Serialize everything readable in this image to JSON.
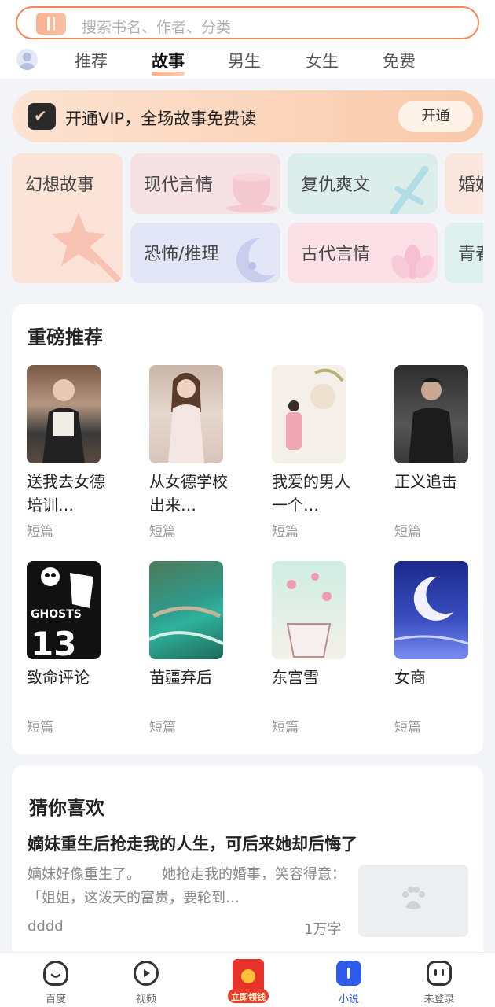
{
  "search": {
    "placeholder": "搜索书名、作者、分类"
  },
  "tabs": [
    "推荐",
    "故事",
    "男生",
    "女生",
    "免费"
  ],
  "active_tab": "故事",
  "vip": {
    "text": "开通VIP，全场故事免费读",
    "button": "开通"
  },
  "categories": [
    "幻想故事",
    "现代言情",
    "复仇爽文",
    "婚姻",
    "恐怖/推理",
    "古代言情",
    "青春"
  ],
  "featured": {
    "title": "重磅推荐",
    "books": [
      {
        "title": "送我去女德培训…",
        "tag": "短篇"
      },
      {
        "title": "从女德学校出来…",
        "tag": "短篇"
      },
      {
        "title": "我爱的男人一个…",
        "tag": "短篇"
      },
      {
        "title": "正义追击",
        "tag": "短篇"
      },
      {
        "title": "致命评论",
        "tag": "短篇"
      },
      {
        "title": "苗疆弃后",
        "tag": "短篇"
      },
      {
        "title": "东宫雪",
        "tag": "短篇"
      },
      {
        "title": "女商",
        "tag": "短篇"
      }
    ]
  },
  "guess": {
    "title": "猜你喜欢",
    "item_title": "嫡妹重生后抢走我的人生，可后来她却后悔了",
    "desc": "嫡妹好像重生了。　　她抢走我的婚事，笑容得意：　　「姐姐，这泼天的富贵，要轮到…",
    "author": "dddd",
    "word_count": "1万字"
  },
  "cover_text": {
    "ghosts": "GHOSTS",
    "num": "13"
  },
  "nav": {
    "home": "百度",
    "video": "视频",
    "earn": "立即领钱",
    "novel": "小说",
    "login": "未登录"
  }
}
